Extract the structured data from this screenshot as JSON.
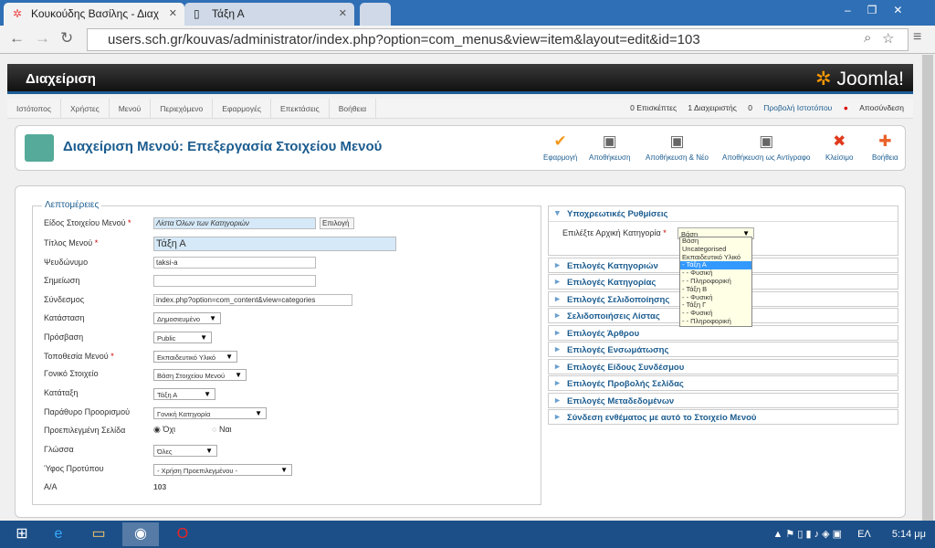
{
  "browser": {
    "tabs": [
      {
        "title": "Κουκούδης Βασίλης - Διαχ",
        "icon": "joomla-icon"
      },
      {
        "title": "Τάξη Α",
        "icon": "page-icon"
      }
    ],
    "url": "users.sch.gr/kouvas/administrator/index.php?option=com_menus&view=item&layout=edit&id=103"
  },
  "header": {
    "title": "Διαχείριση",
    "logo": "Joomla!"
  },
  "menu": [
    "Ιστότοπος",
    "Χρήστες",
    "Μενού",
    "Περιεχόμενο",
    "Εφαρμογές",
    "Επεκτάσεις",
    "Βοήθεια"
  ],
  "status": {
    "visitors": "0 Επισκέπτες",
    "admins": "1 Διαχειριστής",
    "messages": "0",
    "view_site": "Προβολή Ιστοτόπου",
    "logout": "Αποσύνδεση"
  },
  "page_title": "Διαχείριση Μενού: Επεξεργασία Στοιχείου Μενού",
  "toolbar": {
    "apply": "Εφαρμογή",
    "save": "Αποθήκευση",
    "save_new": "Αποθήκευση & Νέο",
    "save_copy": "Αποθήκευση ως Αντίγραφο",
    "close": "Κλείσιμο",
    "help": "Βοήθεια"
  },
  "details": {
    "legend": "Λεπτομέρειες",
    "type_label": "Είδος Στοιχείου Μενού",
    "type_value": "Λίστα Όλων των Κατηγοριών",
    "select_btn": "Επιλογή",
    "title_label": "Τίτλος Μενού",
    "title_value": "Τάξη Α",
    "alias_label": "Ψευδώνυμο",
    "alias_value": "taksi-a",
    "note_label": "Σημείωση",
    "note_value": "",
    "link_label": "Σύνδεσμος",
    "link_value": "index.php?option=com_content&view=categories",
    "status_label": "Κατάσταση",
    "status_value": "Δημοσιευμένο",
    "access_label": "Πρόσβαση",
    "access_value": "Public",
    "menu_loc_label": "Τοποθεσία Μενού",
    "menu_loc_value": "Εκπαιδευτικό Υλικό",
    "parent_label": "Γονικό Στοιχείο",
    "parent_value": "Βάση Στοιχείου Μενού",
    "order_label": "Κατάταξη",
    "order_value": "Τάξη Α",
    "target_label": "Παράθυρο Προορισμού",
    "target_value": "Γονική Κατηγορία",
    "home_label": "Προεπιλεγμένη Σελίδα",
    "home_no": "Όχι",
    "home_yes": "Ναι",
    "lang_label": "Γλώσσα",
    "lang_value": "Όλες",
    "style_label": "Ύφος Προτύπου",
    "style_value": "- Χρήση Προεπιλεγμένου -",
    "id_label": "Α/Α",
    "id_value": "103"
  },
  "required": {
    "title": "Υποχρεωτικές Ρυθμίσεις",
    "cat_label": "Επιλέξτε Αρχική Κατηγορία",
    "cat_value": "Βάση",
    "options": [
      "Βάση",
      "Uncategorised",
      "Εκπαιδευτικό Υλικό",
      "- Τάξη Α",
      "- - Φυσική",
      "- - Πληροφορική",
      "- Τάξη Β",
      "- - Φυσική",
      "- Τάξη Γ",
      "- - Φυσική",
      "- - Πληροφορική"
    ],
    "highlighted_index": 3
  },
  "panes": [
    "Επιλογές Κατηγοριών",
    "Επιλογές Κατηγορίας",
    "Επιλογές Σελιδοποίησης",
    "Σελιδοποιήσεις Λίστας",
    "Επιλογές Άρθρου",
    "Επιλογές Ενσωμάτωσης",
    "Επιλογές Είδους Συνδέσμου",
    "Επιλογές Προβολής Σελίδας",
    "Επιλογές Μεταδεδομένων",
    "Σύνδεση ενθέματος με αυτό το Στοιχείο Μενού"
  ],
  "taskbar": {
    "lang": "ΕΛ",
    "time": "5:14 μμ"
  }
}
